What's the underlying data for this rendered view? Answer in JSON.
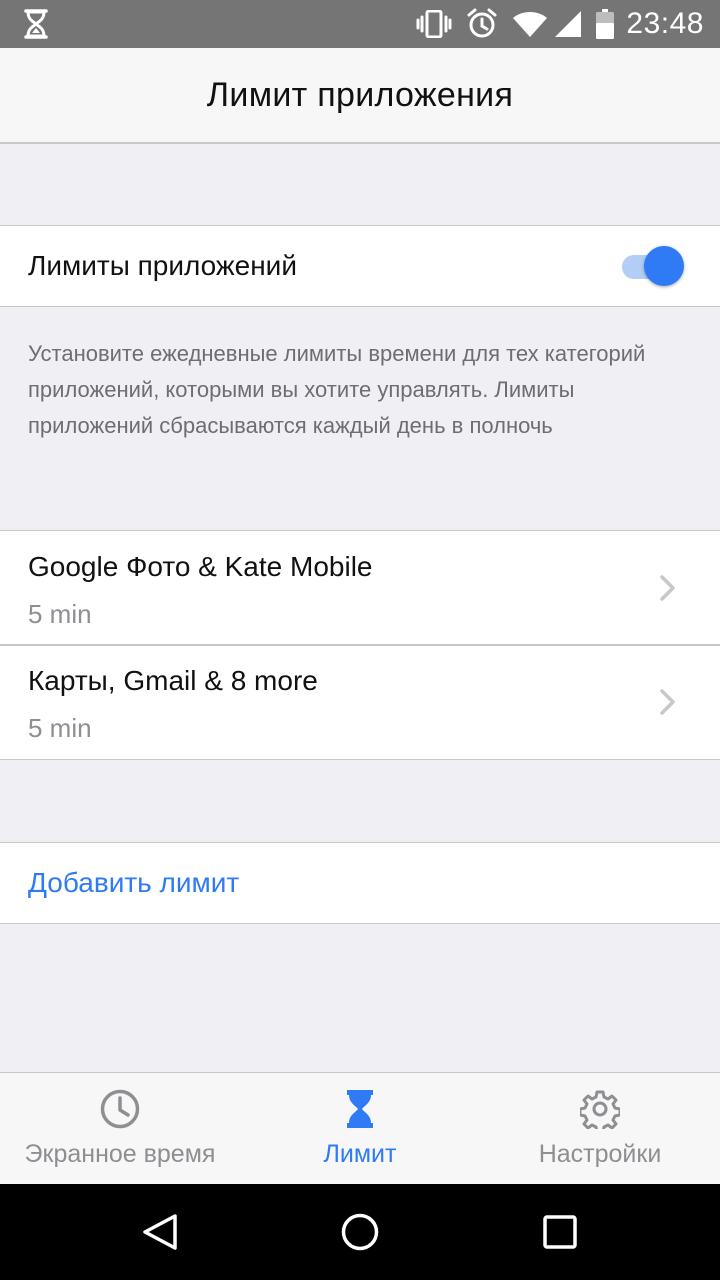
{
  "status_bar": {
    "time": "23:48",
    "icons": [
      "hourglass-icon",
      "vibrate-icon",
      "alarm-icon",
      "wifi-icon",
      "cell-signal-icon",
      "battery-icon"
    ]
  },
  "header": {
    "title": "Лимит приложения"
  },
  "toggle": {
    "label": "Лимиты приложений",
    "enabled": true
  },
  "description": "Установите ежедневные лимиты времени для тех категорий приложений, которыми вы хотите управлять. Лимиты приложений сбрасываются каждый день в полночь",
  "limits": [
    {
      "title": "Google Фото & Kate Mobile",
      "duration": "5 min"
    },
    {
      "title": "Карты, Gmail & 8 more",
      "duration": "5 min"
    }
  ],
  "add_limit_label": "Добавить лимит",
  "tabs": [
    {
      "label": "Экранное время",
      "icon": "clock-icon",
      "active": false
    },
    {
      "label": "Лимит",
      "icon": "hourglass-icon",
      "active": true
    },
    {
      "label": "Настройки",
      "icon": "gear-icon",
      "active": false
    }
  ],
  "colors": {
    "accent": "#2f7bf5",
    "inactive": "#8e8e93",
    "background": "#efeff4"
  }
}
